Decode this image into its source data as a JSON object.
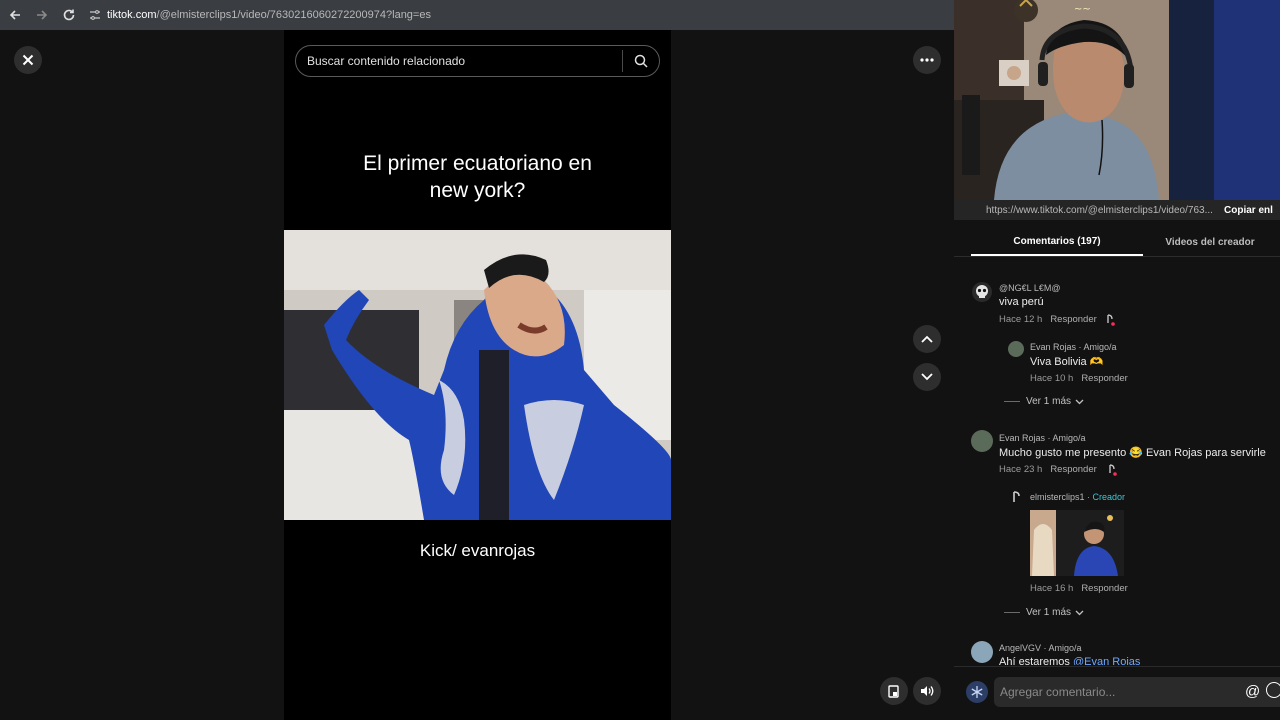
{
  "browser": {
    "url_domain": "tiktok.com",
    "url_path": "/@elmisterclips1/video/7630216060272200974?lang=es"
  },
  "viewer": {
    "search_placeholder": "Buscar contenido relacionado",
    "video_title_line1": "El primer ecuatoriano en",
    "video_title_line2": "new york?",
    "video_caption": "Kick/ evanrojas"
  },
  "panel": {
    "share_url": "https://www.tiktok.com/@elmisterclips1/video/763...",
    "copy_label": "Copiar enl",
    "tabs": [
      {
        "label": "Comentarios (197)"
      },
      {
        "label": "Videos del creador"
      }
    ],
    "comments": [
      {
        "user": "@NG€L L€M@",
        "text": "viva perú",
        "time": "Hace 12 h",
        "reply": "Responder"
      },
      {
        "user": "Evan Rojas · Amigo/a",
        "text": "Viva Bolivia 🫶",
        "time": "Hace 10 h",
        "reply": "Responder"
      },
      {
        "view_more": "Ver 1 más"
      },
      {
        "user": "Evan Rojas · Amigo/a",
        "text": "Mucho gusto me presento 😂 Evan Rojas para servirle",
        "time": "Hace 23 h",
        "reply": "Responder"
      },
      {
        "user": "elmisterclips1",
        "creator_tag": "· Creador",
        "time": "Hace 16 h",
        "reply": "Responder"
      },
      {
        "view_more": "Ver 1 más"
      },
      {
        "user": "AngelVGV · Amigo/a",
        "text_prefix": "Ahí estaremos ",
        "mention": "@Evan Rojas"
      }
    ],
    "composer_placeholder": "Agregar comentario...",
    "composer_at": "@"
  },
  "colors": {
    "creator": "#3ec6d8",
    "mention": "#6fa8ff",
    "background": "#121212"
  }
}
